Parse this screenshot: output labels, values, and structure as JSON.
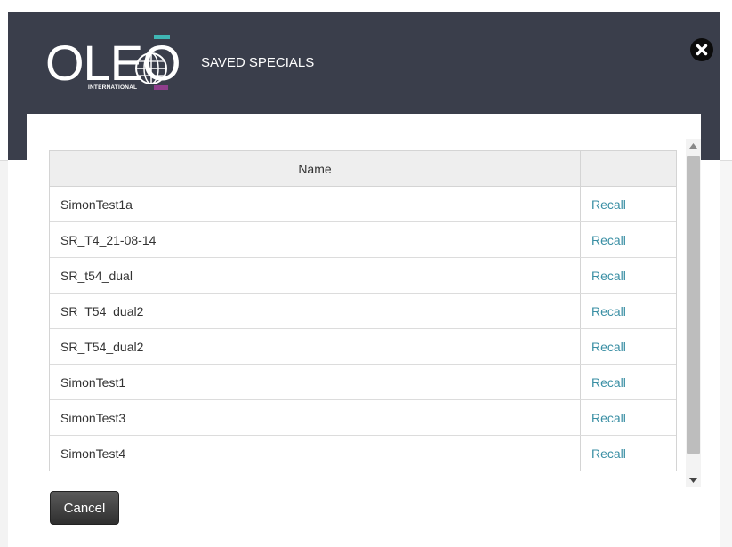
{
  "header": {
    "logo": {
      "name": "OLEO",
      "subtitle": "INTERNATIONAL",
      "colors": {
        "teal": "#3fb6b4",
        "purple": "#8f3e8c"
      }
    },
    "title": "SAVED SPECIALS",
    "close_icon": "close-circle-icon"
  },
  "table": {
    "columns": [
      "Name",
      ""
    ],
    "rows": [
      {
        "name": "SimonTest1a",
        "action": "Recall"
      },
      {
        "name": "SR_T4_21-08-14",
        "action": "Recall"
      },
      {
        "name": "SR_t54_dual",
        "action": "Recall"
      },
      {
        "name": "SR_T54_dual2",
        "action": "Recall"
      },
      {
        "name": "SR_T54_dual2",
        "action": "Recall"
      },
      {
        "name": "SimonTest1",
        "action": "Recall"
      },
      {
        "name": "SimonTest3",
        "action": "Recall"
      },
      {
        "name": "SimonTest4",
        "action": "Recall"
      }
    ]
  },
  "footer": {
    "cancel_label": "Cancel"
  },
  "colors": {
    "header_bg": "#3a3e4b",
    "link": "#3a8fa4",
    "button_bg": "#3f3f3f"
  }
}
